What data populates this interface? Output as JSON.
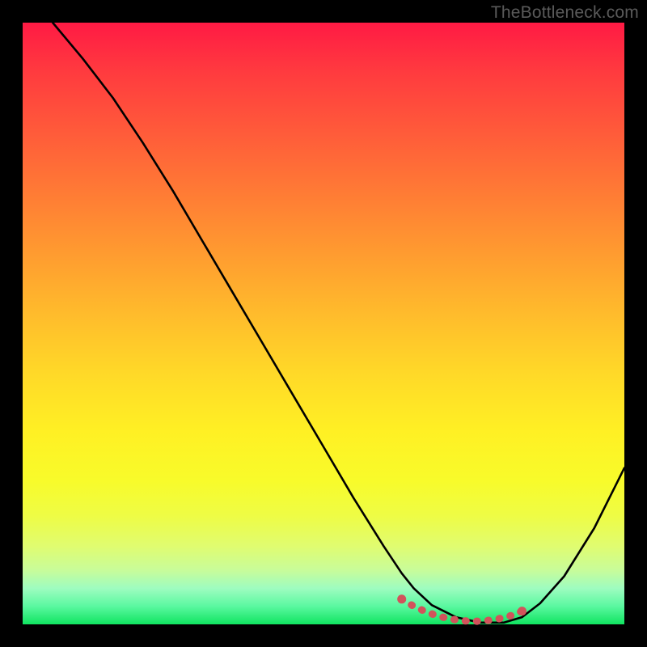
{
  "watermark": "TheBottleneck.com",
  "chart_data": {
    "type": "line",
    "title": "",
    "xlabel": "",
    "ylabel": "",
    "xlim": [
      0,
      100
    ],
    "ylim": [
      0,
      100
    ],
    "gradient_stops": [
      {
        "pct": 0,
        "color": "#ff1a44"
      },
      {
        "pct": 8,
        "color": "#ff3a3f"
      },
      {
        "pct": 18,
        "color": "#ff5a3a"
      },
      {
        "pct": 28,
        "color": "#ff7a35"
      },
      {
        "pct": 38,
        "color": "#ff9a30"
      },
      {
        "pct": 48,
        "color": "#ffba2c"
      },
      {
        "pct": 58,
        "color": "#ffd828"
      },
      {
        "pct": 68,
        "color": "#fff024"
      },
      {
        "pct": 76,
        "color": "#f8fb2a"
      },
      {
        "pct": 82,
        "color": "#eefc45"
      },
      {
        "pct": 87,
        "color": "#e0fc70"
      },
      {
        "pct": 91,
        "color": "#c8fc9a"
      },
      {
        "pct": 94,
        "color": "#9efcc0"
      },
      {
        "pct": 97,
        "color": "#5af8a0"
      },
      {
        "pct": 100,
        "color": "#10e460"
      }
    ],
    "series": [
      {
        "name": "curve",
        "color": "#000000",
        "x": [
          5,
          10,
          15,
          20,
          25,
          30,
          35,
          40,
          45,
          50,
          55,
          60,
          63,
          65,
          68,
          72,
          76,
          80,
          83,
          86,
          90,
          95,
          100
        ],
        "y": [
          100,
          94,
          87.5,
          80,
          72,
          63.5,
          55,
          46.5,
          38,
          29.5,
          21,
          13,
          8.5,
          6,
          3.2,
          1.2,
          0.3,
          0.3,
          1.2,
          3.5,
          8,
          16,
          26
        ]
      },
      {
        "name": "flat-marker",
        "color": "#d1535b",
        "x": [
          63,
          65,
          67,
          69,
          71,
          73,
          75,
          77,
          79,
          81,
          83
        ],
        "y": [
          4.2,
          3.0,
          2.1,
          1.4,
          0.9,
          0.6,
          0.5,
          0.6,
          0.9,
          1.4,
          2.2
        ]
      }
    ]
  }
}
